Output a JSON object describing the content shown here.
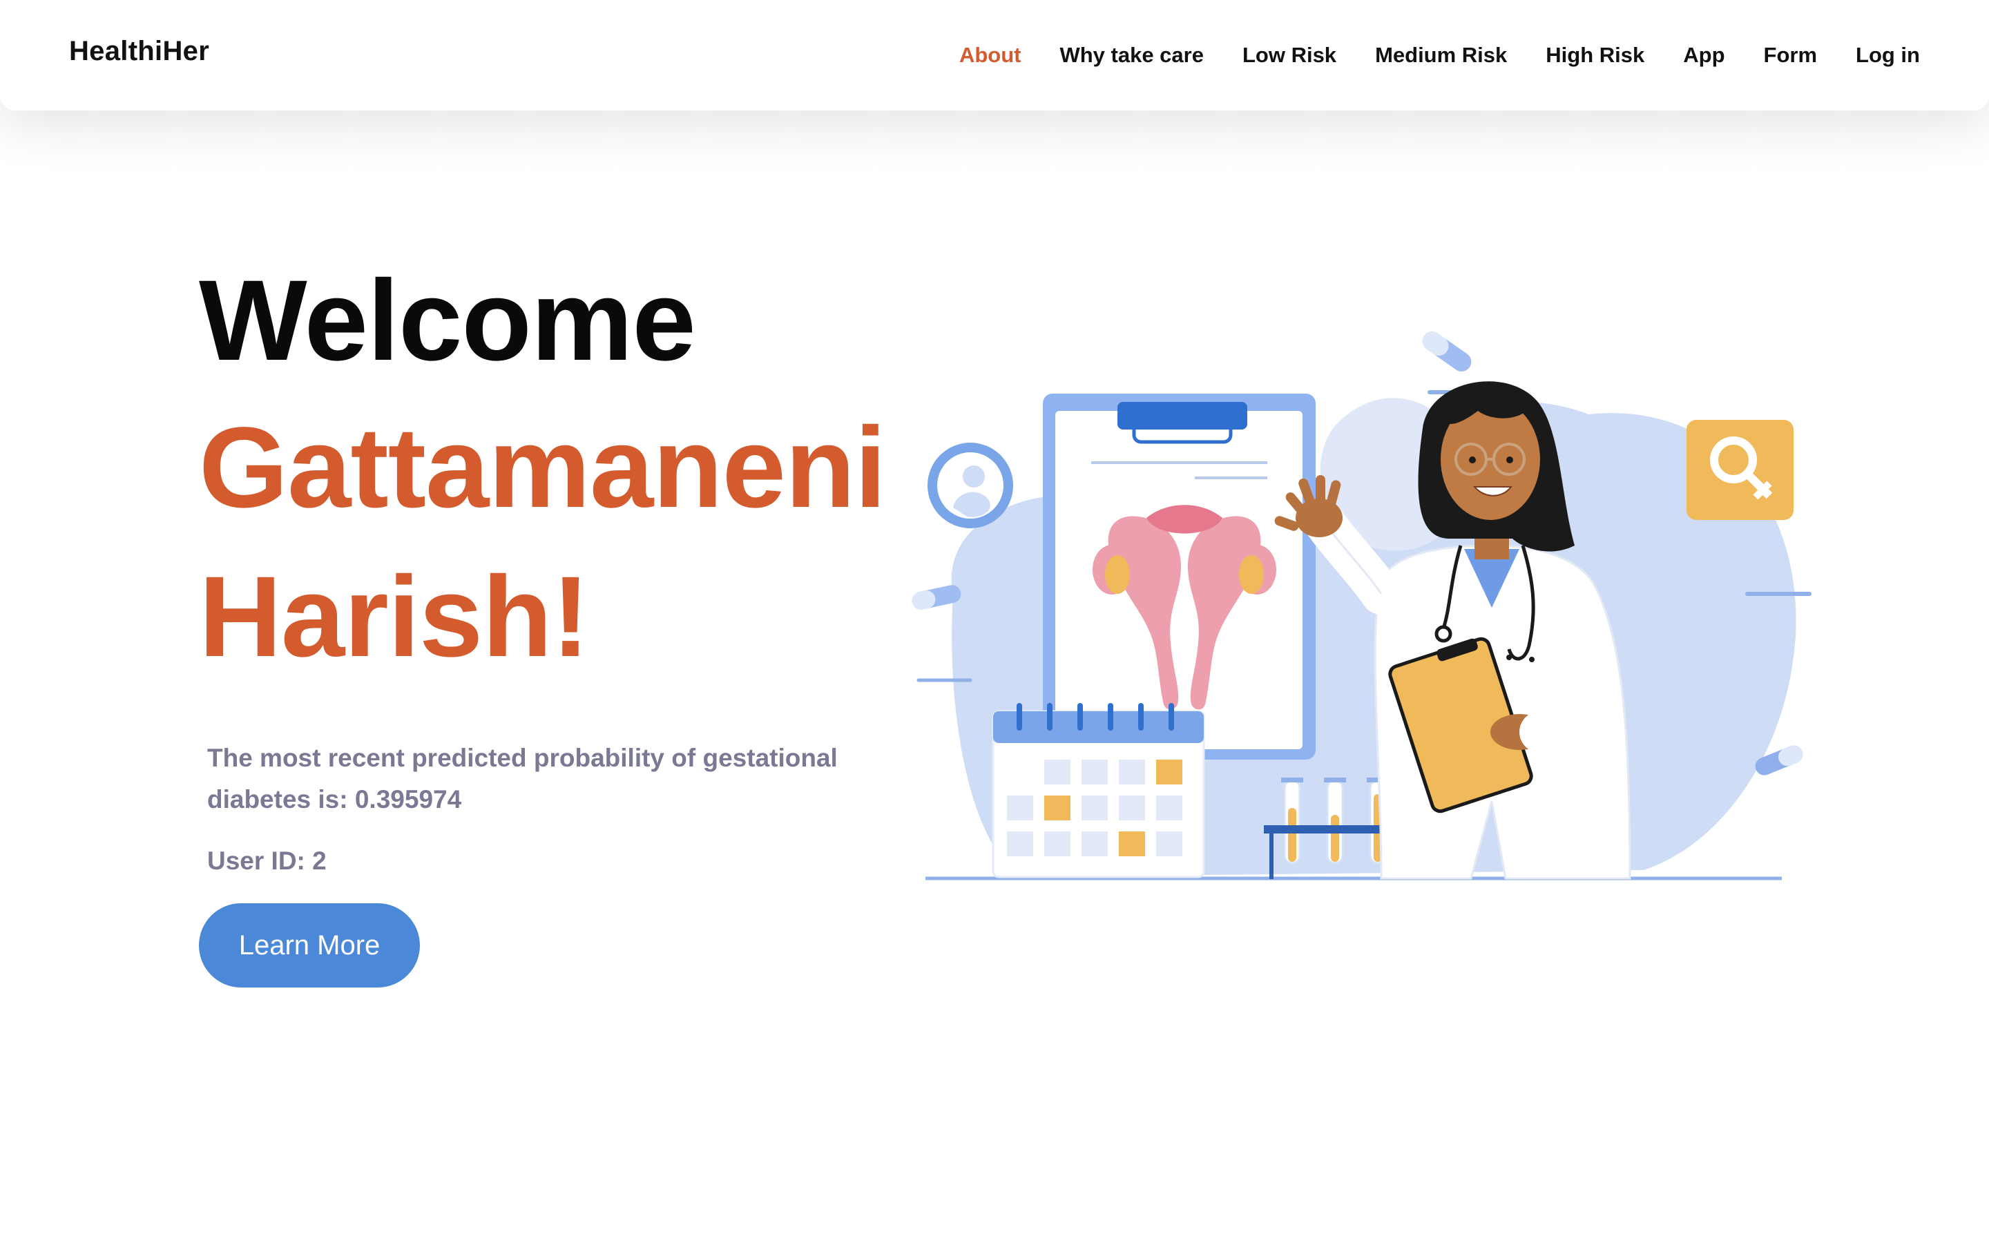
{
  "header": {
    "brand": "HealthiHer",
    "nav": [
      {
        "label": "About",
        "active": true
      },
      {
        "label": "Why take care",
        "active": false
      },
      {
        "label": "Low Risk",
        "active": false
      },
      {
        "label": "Medium Risk",
        "active": false
      },
      {
        "label": "High Risk",
        "active": false
      },
      {
        "label": "App",
        "active": false
      },
      {
        "label": "Form",
        "active": false
      },
      {
        "label": "Log in",
        "active": false
      }
    ]
  },
  "hero": {
    "welcome": "Welcome",
    "name_line1": "Gattamaneni",
    "name_line2": "Harish!",
    "probability_text": "The most recent predicted probability of gestational diabetes is: 0.395974",
    "user_id_text": "User ID: 2",
    "cta_label": "Learn More"
  },
  "illustration": {
    "subject": "doctor-with-clipboard-and-uterus-chart"
  },
  "colors": {
    "accent": "#d35b2e",
    "button": "#4c88d8",
    "muted_text": "#7a7994",
    "illustration_blue": "#c9d8f4",
    "illustration_yellow": "#f0b95a"
  }
}
